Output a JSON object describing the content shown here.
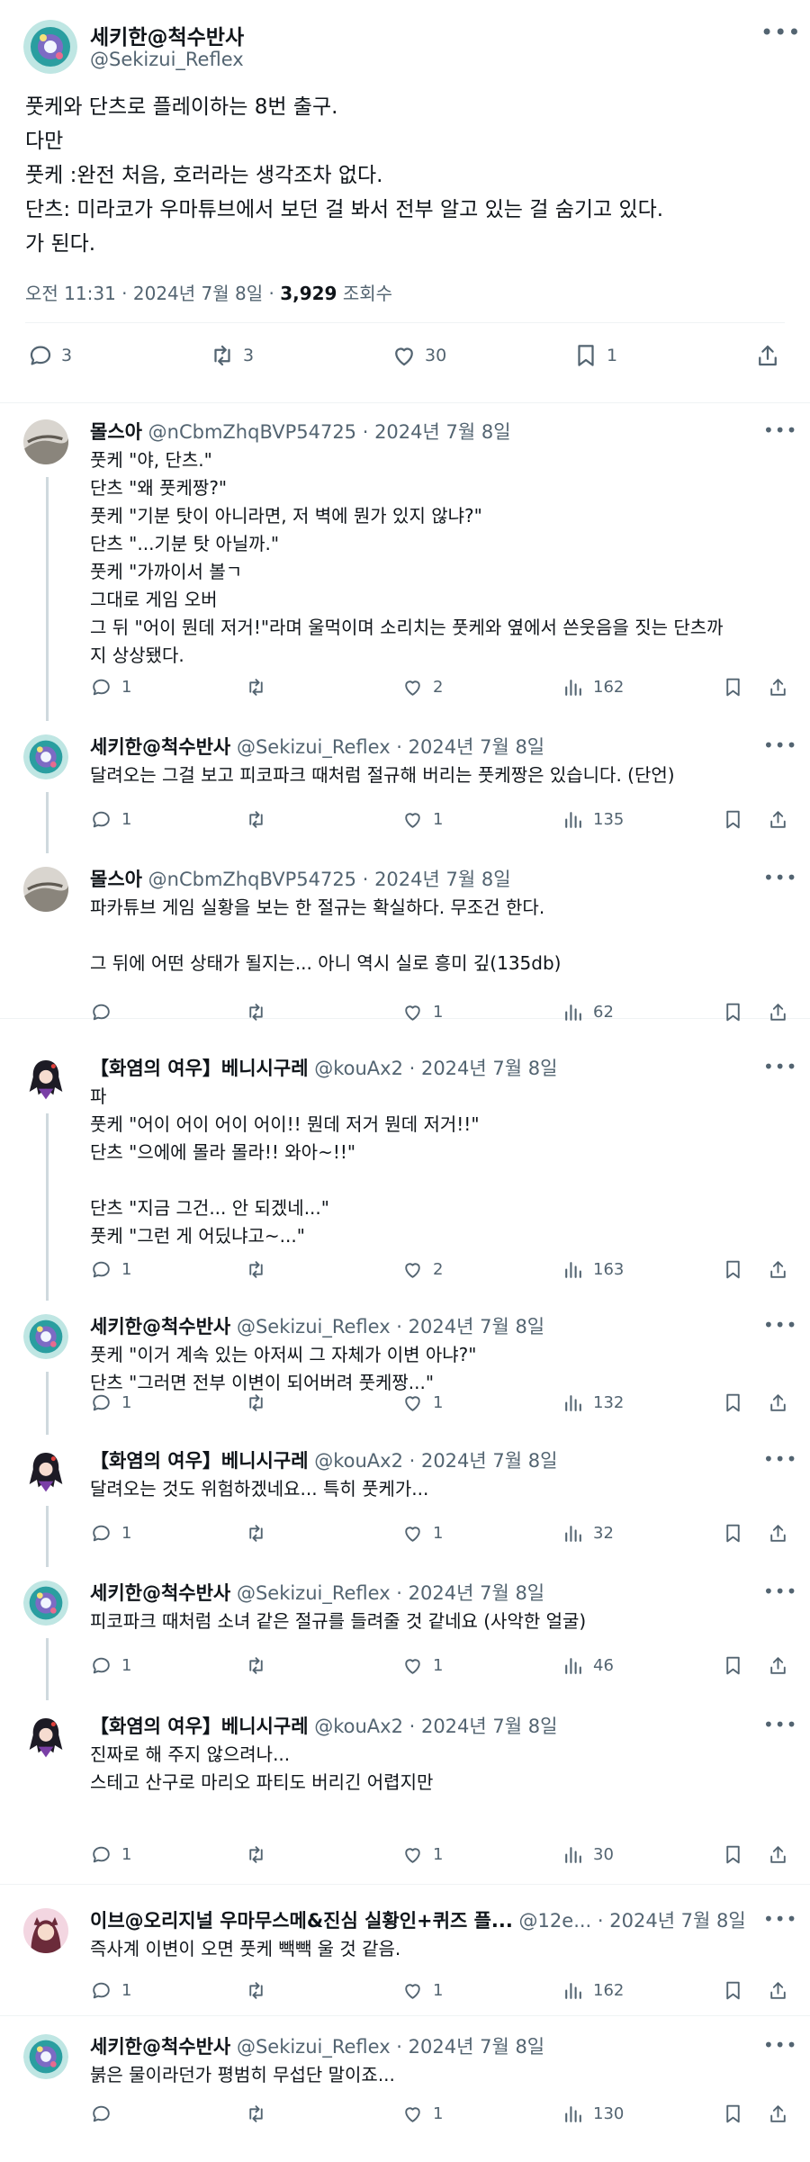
{
  "main_post": {
    "name": "세키한@척수반사",
    "handle": "@Sekizui_Reflex",
    "text": "풋케와 단츠로 플레이하는 8번 출구.\n다만\n풋케 :완전 처음, 호러라는 생각조차 없다.\n단츠: 미라코가 우마튜브에서 보던 걸 봐서 전부 알고 있는 걸 숨기고 있다.\n가 된다.",
    "time": "오전 11:31 · 2024년 7월 8일 · ",
    "views": "3,929",
    "views_label": " 조회수",
    "replies": "3",
    "retweets": "3",
    "likes": "30",
    "bookmarks": "1"
  },
  "replies": [
    {
      "name": "몰스아",
      "handle": "@nCbmZhqBVP54725",
      "date": " · 2024년 7월 8일",
      "avatar": "rock",
      "text": "풋케 \"야, 단츠.\"\n단츠 \"왜 풋케짱?\"\n풋케 \"기분 탓이 아니라면, 저 벽에 뭔가 있지 않냐?\"\n단츠 \"...기분 탓 아닐까.\"\n풋케 \"가까이서 볼ㄱ\n그대로 게임 오버\n그 뒤 \"어이 뭔데 저거!\"라며 울먹이며 소리치는 풋케와 옆에서 쓴웃음을 짓는 단츠까\n지 상상됐다.",
      "replies": "1",
      "retweets": "",
      "likes": "2",
      "views": "162"
    },
    {
      "name": "세키한@척수반사",
      "handle": "@Sekizui_Reflex",
      "date": " · 2024년 7월 8일",
      "avatar": "teal",
      "text": "달려오는 그걸 보고 피코파크 때처럼 절규해 버리는 풋케짱은 있습니다. (단언)",
      "replies": "1",
      "retweets": "",
      "likes": "1",
      "views": "135"
    },
    {
      "name": "몰스아",
      "handle": "@nCbmZhqBVP54725",
      "date": " · 2024년 7월 8일",
      "avatar": "rock",
      "text": "파카튜브 게임 실황을 보는 한 절규는 확실하다. 무조건 한다.\n\n그 뒤에 어떤 상태가 될지는... 아니 역시 실로 흥미 깊(135db)",
      "replies": "",
      "retweets": "",
      "likes": "1",
      "views": "62"
    },
    {
      "name": "【화염의 여우】베니시구레",
      "handle": "@kouAx2",
      "date": " · 2024년 7월 8일",
      "avatar": "anime",
      "text": "파\n풋케 \"어이 어이 어이 어이!! 뭔데 저거 뭔데 저거!!\"\n단츠 \"으에에 몰라 몰라!! 와아~!!\"\n\n단츠 \"지금 그건... 안 되겠네...\"\n풋케 \"그런 게 어딨냐고~...\"",
      "replies": "1",
      "retweets": "",
      "likes": "2",
      "views": "163"
    },
    {
      "name": "세키한@척수반사",
      "handle": "@Sekizui_Reflex",
      "date": " · 2024년 7월 8일",
      "avatar": "teal",
      "text": "풋케 \"이거 계속 있는 아저씨 그 자체가 이변 아냐?\"\n단츠 \"그러면 전부 이변이 되어버려 풋케짱...\"",
      "replies": "1",
      "retweets": "",
      "likes": "1",
      "views": "132"
    },
    {
      "name": "【화염의 여우】베니시구레",
      "handle": "@kouAx2",
      "date": " · 2024년 7월 8일",
      "avatar": "anime",
      "text": "달려오는 것도 위험하겠네요... 특히 풋케가...",
      "replies": "1",
      "retweets": "",
      "likes": "1",
      "views": "32"
    },
    {
      "name": "세키한@척수반사",
      "handle": "@Sekizui_Reflex",
      "date": " · 2024년 7월 8일",
      "avatar": "teal",
      "text": "피코파크 때처럼 소녀 같은 절규를 들려줄 것 같네요 (사악한 얼굴)",
      "replies": "1",
      "retweets": "",
      "likes": "1",
      "views": "46"
    },
    {
      "name": "【화염의 여우】베니시구레",
      "handle": "@kouAx2",
      "date": " · 2024년 7월 8일",
      "avatar": "anime",
      "text": "진짜로 해 주지 않으려나...\n스테고 산구로 마리오 파티도 버리긴 어렵지만",
      "replies": "1",
      "retweets": "",
      "likes": "1",
      "views": "30"
    },
    {
      "name": "이브@오리지널 우마무스메&진심 실황인+퀴즈 플...",
      "handle": "@12e...",
      "date": " · 2024년 7월 8일",
      "avatar": "pink",
      "text": "즉사계 이변이 오면 풋케 빽빽 울 것 같음.",
      "replies": "1",
      "retweets": "",
      "likes": "1",
      "views": "162"
    },
    {
      "name": "세키한@척수반사",
      "handle": "@Sekizui_Reflex",
      "date": " · 2024년 7월 8일",
      "avatar": "teal",
      "text": "붉은 물이라던가 평범히 무섭단 말이죠...",
      "replies": "",
      "retweets": "",
      "likes": "1",
      "views": "130"
    }
  ],
  "colors": {
    "text": "#0f1419",
    "muted": "#536471",
    "divider": "#eff3f4",
    "thread": "#cfd9de"
  }
}
